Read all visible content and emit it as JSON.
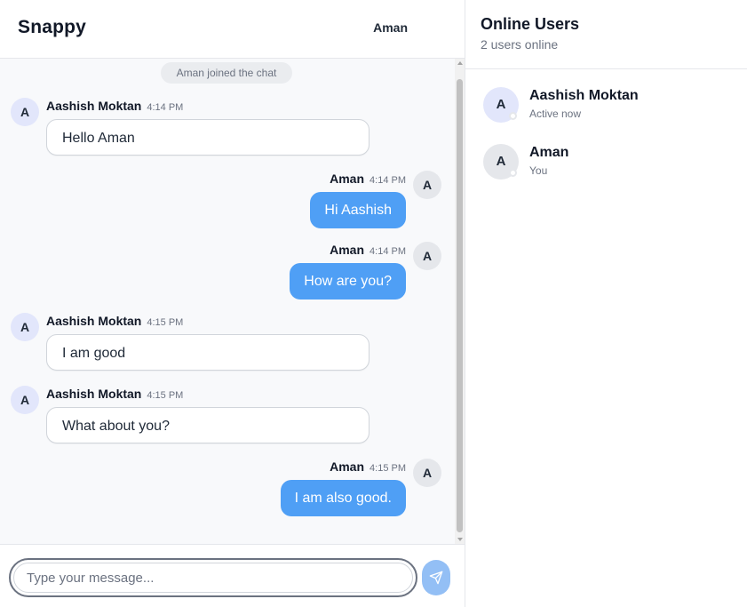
{
  "app": {
    "brand": "Snappy",
    "current_user": "Aman"
  },
  "chat": {
    "system_message": "Aman joined the chat",
    "messages": [
      {
        "sender": "Aashish Moktan",
        "initial": "A",
        "time": "4:14 PM",
        "text": "Hello Aman",
        "mine": false
      },
      {
        "sender": "Aman",
        "initial": "A",
        "time": "4:14 PM",
        "text": "Hi Aashish",
        "mine": true
      },
      {
        "sender": "Aman",
        "initial": "A",
        "time": "4:14 PM",
        "text": "How are you?",
        "mine": true
      },
      {
        "sender": "Aashish Moktan",
        "initial": "A",
        "time": "4:15 PM",
        "text": "I am good",
        "mine": false
      },
      {
        "sender": "Aashish Moktan",
        "initial": "A",
        "time": "4:15 PM",
        "text": "What about you?",
        "mine": false
      },
      {
        "sender": "Aman",
        "initial": "A",
        "time": "4:15 PM",
        "text": "I am also good.",
        "mine": true
      }
    ],
    "input_placeholder": "Type your message...",
    "input_value": "",
    "send_icon": "send-icon"
  },
  "online_panel": {
    "title": "Online Users",
    "subtitle": "2 users online",
    "users": [
      {
        "initial": "A",
        "name": "Aashish Moktan",
        "status": "Active now"
      },
      {
        "initial": "A",
        "name": "Aman",
        "status": "You"
      }
    ]
  },
  "colors": {
    "my_bubble": "#4f9ff5",
    "send_button": "#93bff5",
    "other_avatar": "#e2e6fb",
    "my_avatar": "#e5e7eb",
    "chat_background": "#f8f9fb"
  }
}
